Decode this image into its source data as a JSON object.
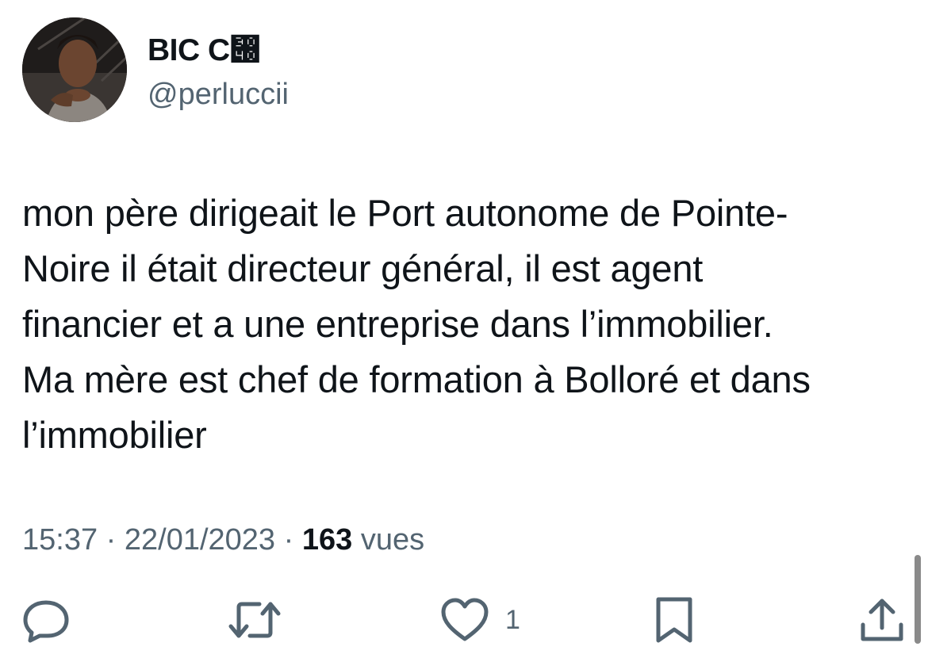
{
  "author": {
    "display_name": "BIC C぀",
    "handle": "@perluccii"
  },
  "tweet": {
    "text_lines": [
      "mon père dirigeait le Port autonome de Pointe-",
      "Noire il était directeur général, il est agent",
      "financier et a une entreprise dans l’immobilier.",
      "Ma mère est chef de formation à Bolloré et dans",
      "l’immobilier"
    ],
    "time": "15:37",
    "separator": " · ",
    "date": "22/01/2023",
    "views_count": "163",
    "views_label": "vues"
  },
  "actions": {
    "reply": {
      "icon": "reply-icon"
    },
    "retweet": {
      "icon": "retweet-icon"
    },
    "like": {
      "icon": "heart-icon",
      "count": "1"
    },
    "bookmark": {
      "icon": "bookmark-icon"
    },
    "share": {
      "icon": "share-icon"
    }
  },
  "colors": {
    "text_primary": "#0f1419",
    "text_secondary": "#536471",
    "background": "#ffffff"
  }
}
